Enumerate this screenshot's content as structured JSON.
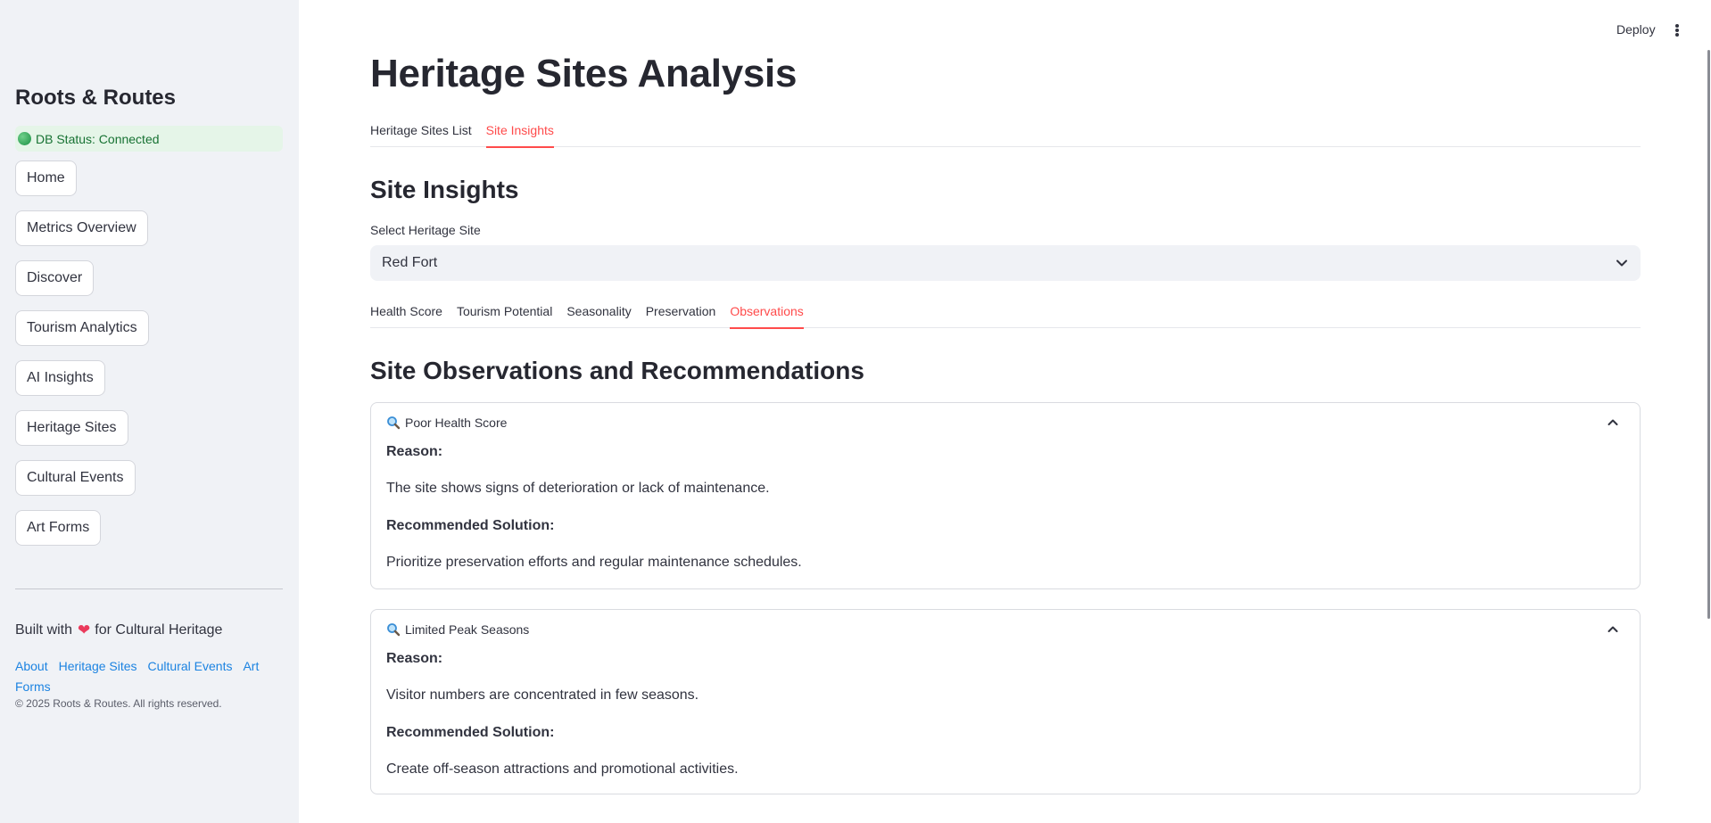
{
  "sidebar": {
    "brand": "Roots & Routes",
    "db_status": "DB Status: Connected",
    "nav": [
      "Home",
      "Metrics Overview",
      "Discover",
      "Tourism Analytics",
      "AI Insights",
      "Heritage Sites",
      "Cultural Events",
      "Art Forms"
    ],
    "built_prefix": "Built with",
    "built_suffix": "for Cultural Heritage",
    "footer_links": [
      "About",
      "Heritage Sites",
      "Cultural Events",
      "Art Forms"
    ],
    "copyright": "© 2025 Roots & Routes. All rights reserved."
  },
  "header": {
    "deploy_label": "Deploy"
  },
  "main": {
    "title": "Heritage Sites Analysis",
    "tabs": [
      "Heritage Sites List",
      "Site Insights"
    ],
    "section_title": "Site Insights",
    "select_label": "Select Heritage Site",
    "select_value": "Red Fort",
    "subtabs": [
      "Health Score",
      "Tourism Potential",
      "Seasonality",
      "Preservation",
      "Observations"
    ],
    "observations_title": "Site Observations and Recommendations",
    "observations": [
      {
        "title": "Poor Health Score",
        "reason_label": "Reason:",
        "reason": "The site shows signs of deterioration or lack of maintenance.",
        "solution_label": "Recommended Solution:",
        "solution": "Prioritize preservation efforts and regular maintenance schedules."
      },
      {
        "title": "Limited Peak Seasons",
        "reason_label": "Reason:",
        "reason": "Visitor numbers are concentrated in few seasons.",
        "solution_label": "Recommended Solution:",
        "solution": "Create off-season attractions and promotional activities."
      }
    ]
  },
  "colors": {
    "accent": "#ff4b4b",
    "sidebar_bg": "#f0f2f6",
    "link": "#1c83e1",
    "status_green": "#177233"
  },
  "icons": {
    "status": "green-circle-icon",
    "heart": "heart-icon",
    "menu": "kebab-menu-icon",
    "expander": "magnifier-icon",
    "select": "chevron-down-icon",
    "collapse": "chevron-up-icon"
  }
}
